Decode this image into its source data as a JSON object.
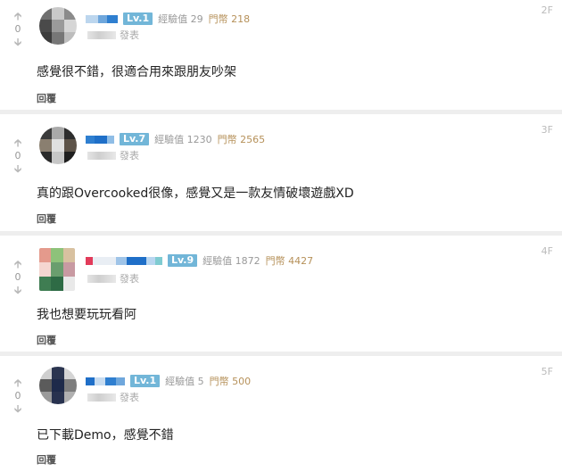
{
  "icons": {
    "upvote": "arrow-up-icon",
    "downvote": "arrow-down-icon"
  },
  "colors": {
    "level_badge": "#72b6d8",
    "coin_text": "#b6915a",
    "divider": "#eeeeee"
  },
  "comments": [
    {
      "votes": "0",
      "level": "Lv.1",
      "exp": "經驗值 29",
      "coins": "門幣 218",
      "time_suffix": "發表",
      "floor": "2F",
      "content": "感覺很不錯，很適合用來跟朋友吵架",
      "reply": "回覆"
    },
    {
      "votes": "0",
      "level": "Lv.7",
      "exp": "經驗值 1230",
      "coins": "門幣 2565",
      "time_suffix": "發表",
      "floor": "3F",
      "content": "真的跟Overcooked很像，感覺又是一款友情破壞遊戲XD",
      "reply": "回覆"
    },
    {
      "votes": "0",
      "level": "Lv.9",
      "exp": "經驗值 1872",
      "coins": "門幣 4427",
      "time_suffix": "發表",
      "floor": "4F",
      "content": "我也想要玩玩看阿",
      "reply": "回覆"
    },
    {
      "votes": "0",
      "level": "Lv.1",
      "exp": "經驗值 5",
      "coins": "門幣 500",
      "time_suffix": "發表",
      "floor": "5F",
      "content": "已下載Demo，感覺不錯",
      "reply": "回覆"
    }
  ]
}
